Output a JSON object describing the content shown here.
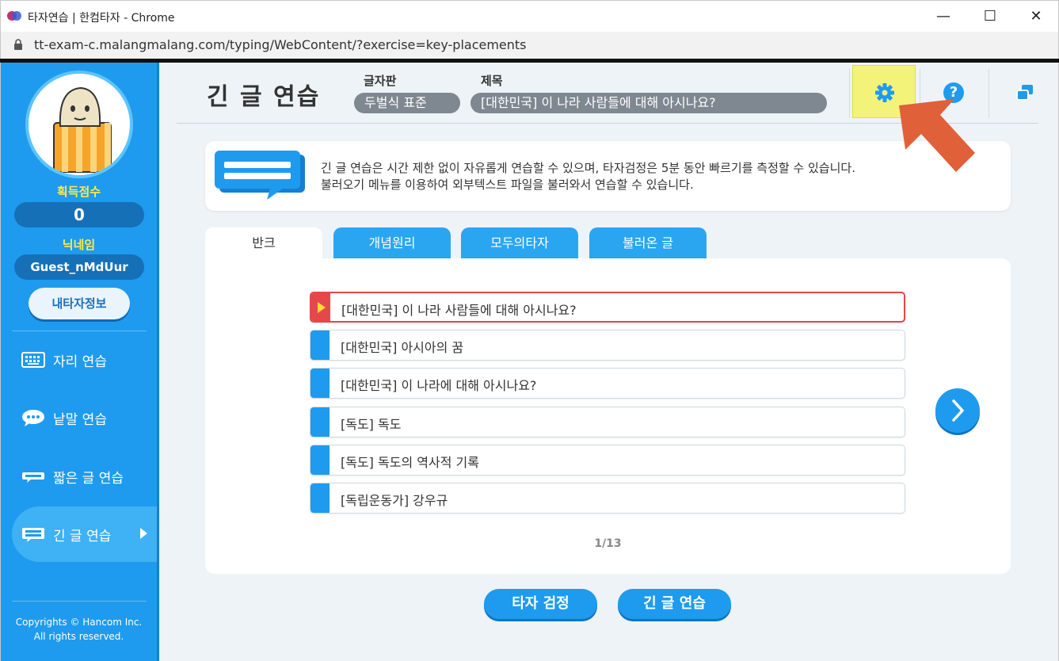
{
  "window": {
    "title": "타자연습 | 한컴타자 - Chrome",
    "url": "tt-exam-c.malangmalang.com/typing/WebContent/?exercise=key-placements",
    "controls": {
      "minimize": "—",
      "maximize": "☐",
      "close": "✕"
    }
  },
  "sidebar": {
    "score_label": "획득점수",
    "score_value": "0",
    "nickname_label": "닉네임",
    "nickname_value": "Guest_nMdUur",
    "myinfo_button": "내타자정보",
    "nav": [
      {
        "label": "자리 연습",
        "icon": "keyboard-icon",
        "active": false
      },
      {
        "label": "낱말 연습",
        "icon": "speech-bubble-icon",
        "active": false
      },
      {
        "label": "짧은 글 연습",
        "icon": "short-text-icon",
        "active": false
      },
      {
        "label": "긴 글 연습",
        "icon": "long-text-icon",
        "active": true
      }
    ],
    "copyright_line1": "Copyrights © Hancom Inc.",
    "copyright_line2": "All rights reserved."
  },
  "header": {
    "title": "긴 글 연습",
    "keyboard_label": "글자판",
    "keyboard_value": "두벌식 표준",
    "subject_label": "제목",
    "subject_value": "[대한민국] 이 나라 사람들에 대해 아시나요?",
    "icons": [
      "settings-gear-icon",
      "help-icon",
      "window-icon"
    ],
    "highlight_color": "#f3f37a"
  },
  "info": {
    "line1": "긴 글 연습은 시간 제한 없이 자유롭게 연습할 수 있으며, 타자검정은 5분 동안 빠르기를 측정할 수 있습니다.",
    "line2": "불러오기 메뉴를 이용하여 외부텍스트 파일을 불러와서 연습할 수 있습니다."
  },
  "tabs": [
    "반크",
    "개념원리",
    "모두의타자",
    "불러온 글"
  ],
  "list": {
    "items": [
      "[대한민국] 이 나라 사람들에 대해 아시나요?",
      "[대한민국] 아시아의 꿈",
      "[대한민국] 이 나라에 대해 아시나요?",
      "[독도] 독도",
      "[독도] 독도의 역사적 기록",
      "[독립운동가] 강우규"
    ],
    "selected_index": 0,
    "page": "1/13"
  },
  "buttons": {
    "test": "타자 검정",
    "long_practice": "긴 글 연습"
  },
  "colors": {
    "primary": "#1e9bee",
    "selected": "#e4484b",
    "annotation_arrow": "#e0603a"
  }
}
